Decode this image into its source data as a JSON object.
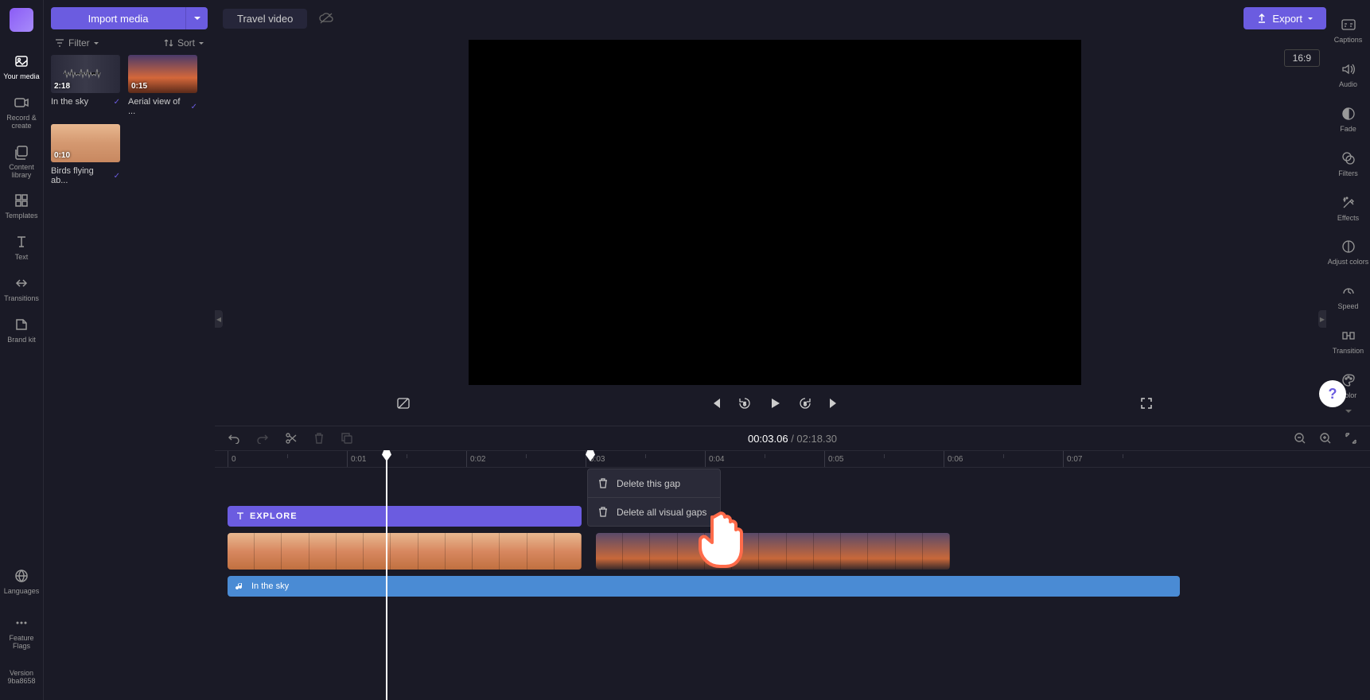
{
  "project_title": "Travel video",
  "import_label": "Import media",
  "filter_label": "Filter",
  "sort_label": "Sort",
  "export_label": "Export",
  "aspect_label": "16:9",
  "left_nav": [
    {
      "label": "Your media"
    },
    {
      "label": "Record & create"
    },
    {
      "label": "Content library"
    },
    {
      "label": "Templates"
    },
    {
      "label": "Text"
    },
    {
      "label": "Transitions"
    },
    {
      "label": "Brand kit"
    }
  ],
  "left_bottom": [
    {
      "label": "Languages"
    },
    {
      "label": "Feature Flags"
    },
    {
      "label": "Version 9ba8658"
    }
  ],
  "right_nav": [
    {
      "label": "Captions"
    },
    {
      "label": "Audio"
    },
    {
      "label": "Fade"
    },
    {
      "label": "Filters"
    },
    {
      "label": "Effects"
    },
    {
      "label": "Adjust colors"
    },
    {
      "label": "Speed"
    },
    {
      "label": "Transition"
    },
    {
      "label": "Color"
    }
  ],
  "media": [
    {
      "dur": "2:18",
      "name": "In the sky"
    },
    {
      "dur": "0:15",
      "name": "Aerial view of ..."
    },
    {
      "dur": "0:10",
      "name": "Birds flying ab..."
    }
  ],
  "playback": {
    "current": "00:03.06",
    "total": "02:18.30"
  },
  "ruler": [
    "0",
    "0:01",
    "0:02",
    "0:03",
    "0:04",
    "0:05",
    "0:06",
    "0:07"
  ],
  "text_track": "EXPLORE",
  "audio_track": "In the sky",
  "context_menu": {
    "item1": "Delete this gap",
    "item2": "Delete all visual gaps"
  }
}
